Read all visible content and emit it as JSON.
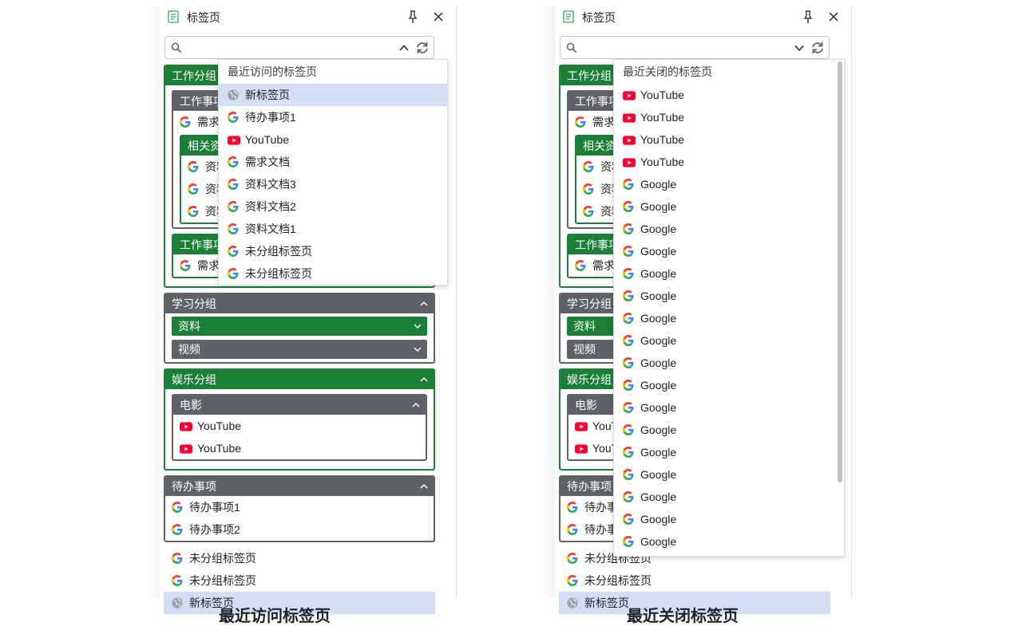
{
  "panel": {
    "title": "标签页",
    "search_placeholder": ""
  },
  "tree": {
    "work_group": {
      "title": "工作分组",
      "sub1": {
        "title": "工作事项",
        "items": [
          "需求文档"
        ],
        "nested": {
          "title": "相关资料",
          "items": [
            "资料文档1",
            "资料文档2",
            "资料文档3"
          ]
        }
      },
      "sub2": {
        "title": "工作事项",
        "items": [
          "需求文档"
        ]
      }
    },
    "study_group": {
      "title": "学习分组",
      "subs": [
        "资料",
        "视频"
      ]
    },
    "fun_group": {
      "title": "娱乐分组",
      "sub": {
        "title": "电影",
        "items": [
          "YouTube",
          "YouTube"
        ]
      }
    },
    "todo_group": {
      "title": "待办事项",
      "items": [
        "待办事项1",
        "待办事项2"
      ]
    },
    "ungrouped": [
      "未分组标签页",
      "未分组标签页"
    ],
    "new_tab": "新标签页"
  },
  "recent_visited": {
    "title": "最近访问的标签页",
    "items": [
      {
        "label": "新标签页",
        "icon": "globe-icon"
      },
      {
        "label": "待办事项1",
        "icon": "google-icon"
      },
      {
        "label": "YouTube",
        "icon": "youtube-icon"
      },
      {
        "label": "需求文档",
        "icon": "google-icon"
      },
      {
        "label": "资料文档3",
        "icon": "google-icon"
      },
      {
        "label": "资料文档2",
        "icon": "google-icon"
      },
      {
        "label": "资料文档1",
        "icon": "google-icon"
      },
      {
        "label": "未分组标签页",
        "icon": "google-icon"
      },
      {
        "label": "未分组标签页",
        "icon": "google-icon"
      }
    ]
  },
  "recent_closed": {
    "title": "最近关闭的标签页",
    "items": [
      {
        "label": "YouTube",
        "icon": "youtube-icon"
      },
      {
        "label": "YouTube",
        "icon": "youtube-icon"
      },
      {
        "label": "YouTube",
        "icon": "youtube-icon"
      },
      {
        "label": "YouTube",
        "icon": "youtube-icon"
      },
      {
        "label": "Google",
        "icon": "google-icon"
      },
      {
        "label": "Google",
        "icon": "google-icon"
      },
      {
        "label": "Google",
        "icon": "google-icon"
      },
      {
        "label": "Google",
        "icon": "google-icon"
      },
      {
        "label": "Google",
        "icon": "google-icon"
      },
      {
        "label": "Google",
        "icon": "google-icon"
      },
      {
        "label": "Google",
        "icon": "google-icon"
      },
      {
        "label": "Google",
        "icon": "google-icon"
      },
      {
        "label": "Google",
        "icon": "google-icon"
      },
      {
        "label": "Google",
        "icon": "google-icon"
      },
      {
        "label": "Google",
        "icon": "google-icon"
      },
      {
        "label": "Google",
        "icon": "google-icon"
      },
      {
        "label": "Google",
        "icon": "google-icon"
      },
      {
        "label": "Google",
        "icon": "google-icon"
      },
      {
        "label": "Google",
        "icon": "google-icon"
      },
      {
        "label": "Google",
        "icon": "google-icon"
      },
      {
        "label": "Google",
        "icon": "google-icon"
      }
    ]
  },
  "captions": {
    "left": "最近访问标签页",
    "right": "最近关闭标签页"
  },
  "colors": {
    "group_green": "#1b7f37",
    "group_gray": "#5f6368",
    "highlight": "#d3def5",
    "youtube_red": "#ff0033"
  }
}
